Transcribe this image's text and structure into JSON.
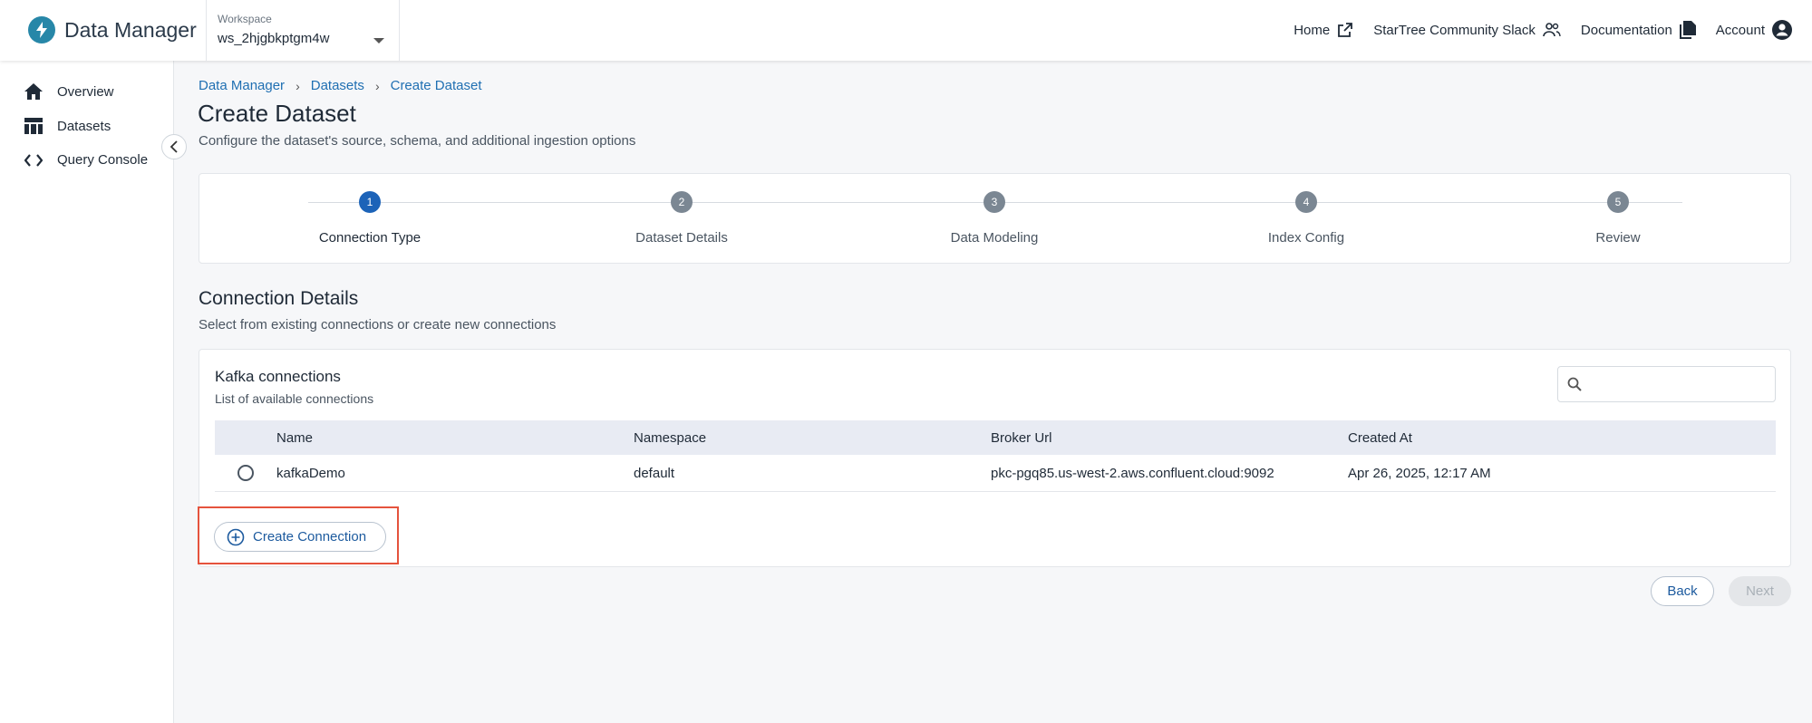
{
  "header": {
    "brand_title": "Data Manager",
    "workspace_label": "Workspace",
    "workspace_value": "ws_2hjgbkptgm4w",
    "nav": [
      {
        "label": "Home",
        "icon": "external-link-icon"
      },
      {
        "label": "StarTree Community Slack",
        "icon": "people-icon"
      },
      {
        "label": "Documentation",
        "icon": "document-icon"
      },
      {
        "label": "Account",
        "icon": "account-icon"
      }
    ]
  },
  "sidebar": {
    "items": [
      {
        "label": "Overview",
        "icon": "home-icon"
      },
      {
        "label": "Datasets",
        "icon": "table-icon"
      },
      {
        "label": "Query Console",
        "icon": "code-icon"
      }
    ]
  },
  "breadcrumb": [
    "Data Manager",
    "Datasets",
    "Create Dataset"
  ],
  "page": {
    "title": "Create Dataset",
    "subtitle": "Configure the dataset's source, schema, and additional ingestion options"
  },
  "stepper": {
    "active": 1,
    "steps": [
      {
        "number": "1",
        "label": "Connection Type"
      },
      {
        "number": "2",
        "label": "Dataset Details"
      },
      {
        "number": "3",
        "label": "Data Modeling"
      },
      {
        "number": "4",
        "label": "Index Config"
      },
      {
        "number": "5",
        "label": "Review"
      }
    ]
  },
  "connection_details": {
    "title": "Connection Details",
    "subtitle": "Select from existing connections or create new connections"
  },
  "kafka": {
    "title": "Kafka connections",
    "subtitle": "List of available connections",
    "search_placeholder": "",
    "columns": [
      "Name",
      "Namespace",
      "Broker Url",
      "Created At"
    ],
    "rows": [
      {
        "name": "kafkaDemo",
        "namespace": "default",
        "broker_url": "pkc-pgq85.us-west-2.aws.confluent.cloud:9092",
        "created_at": "Apr 26, 2025, 12:17 AM"
      }
    ],
    "create_label": "Create Connection"
  },
  "footer": {
    "back_label": "Back",
    "next_label": "Next"
  },
  "colors": {
    "accent": "#1c63b8",
    "brand": "#2787a8",
    "highlight": "#e5533d"
  }
}
